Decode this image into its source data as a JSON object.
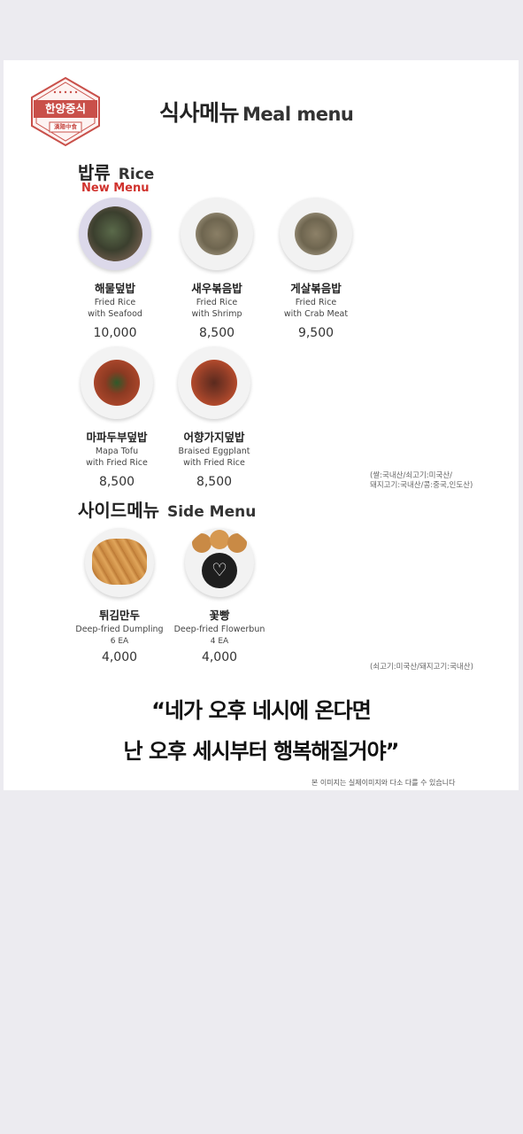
{
  "logo": {
    "name": "한양중식",
    "sub": "漢陽中食"
  },
  "title": {
    "ko": "식사메뉴",
    "en": "Meal menu"
  },
  "rice": {
    "ko": "밥류",
    "en": "Rice",
    "new_label": "New Menu",
    "items": [
      {
        "ko": "해물덮밥",
        "en1": "Fried Rice",
        "en2": "with Seafood",
        "price": "10,000"
      },
      {
        "ko": "새우볶음밥",
        "en1": "Fried Rice",
        "en2": "with Shrimp",
        "price": "8,500"
      },
      {
        "ko": "게살볶음밥",
        "en1": "Fried Rice",
        "en2": "with Crab Meat",
        "price": "9,500"
      },
      {
        "ko": "마파두부덮밥",
        "en1": "Mapa Tofu",
        "en2": "with Fried Rice",
        "price": "8,500"
      },
      {
        "ko": "어향가지덮밥",
        "en1": "Braised Eggplant",
        "en2": "with Fried Rice",
        "price": "8,500"
      }
    ],
    "origin_line1": "(쌀:국내산/쇠고기:미국산/",
    "origin_line2": "돼지고기:국내산/콩:중국,인도산)"
  },
  "side": {
    "ko": "사이드메뉴",
    "en": "Side Menu",
    "items": [
      {
        "ko": "튀김만두",
        "en1": "Deep-fried Dumpling",
        "count": "6 EA",
        "price": "4,000"
      },
      {
        "ko": "꽃빵",
        "en1": "Deep-fried Flowerbun",
        "count": "4 EA",
        "price": "4,000"
      }
    ],
    "origin": "(쇠고기:미국산/돼지고기:국내산)"
  },
  "quote": {
    "line1": "“네가 오후 네시에 온다면",
    "line2": "난 오후 세시부터 행복해질거야”"
  },
  "note": "본 이미지는 실제이미지와 다소 다를 수 있습니다",
  "colors": {
    "accent_red": "#d0322d",
    "logo_red": "#c9504a",
    "page_bg": "#ecebf0"
  }
}
